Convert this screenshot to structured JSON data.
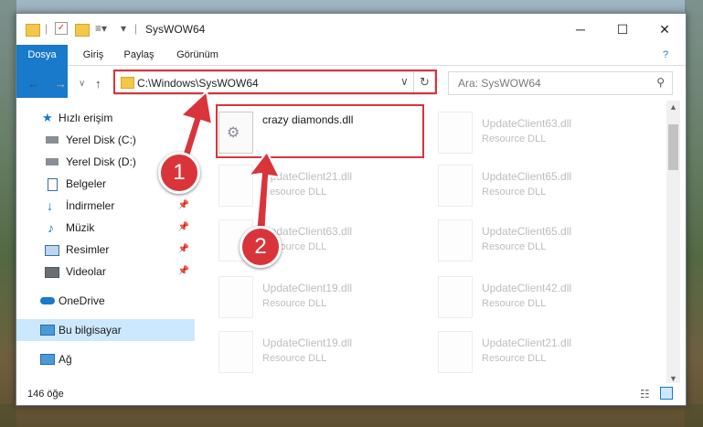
{
  "window": {
    "title": "SysWOW64",
    "minimize_glyph": "─",
    "maximize_glyph": "☐",
    "close_glyph": "✕"
  },
  "ribbon": {
    "tabs": [
      {
        "label": "Dosya",
        "active": true
      },
      {
        "label": "Giriş"
      },
      {
        "label": "Paylaş"
      },
      {
        "label": "Görünüm"
      }
    ],
    "help_glyph": "?"
  },
  "address": {
    "path": "C:\\Windows\\SysWOW64",
    "search_placeholder": "Ara: SysWOW64"
  },
  "sidebar": {
    "items": [
      {
        "label": "Hızlı erişim",
        "icon": "star-icon",
        "pinned": false
      },
      {
        "label": "Yerel Disk (C:)",
        "icon": "drive-icon",
        "pinned": false
      },
      {
        "label": "Yerel Disk (D:)",
        "icon": "drive-icon",
        "pinned": false
      },
      {
        "label": "Belgeler",
        "icon": "document-icon",
        "pinned": true
      },
      {
        "label": "İndirmeler",
        "icon": "download-icon",
        "pinned": true
      },
      {
        "label": "Müzik",
        "icon": "music-icon",
        "pinned": true
      },
      {
        "label": "Resimler",
        "icon": "pictures-icon",
        "pinned": true
      },
      {
        "label": "Videolar",
        "icon": "video-icon",
        "pinned": true
      },
      {
        "label": "OneDrive",
        "icon": "cloud-icon",
        "pinned": false
      },
      {
        "label": "Bu bilgisayar",
        "icon": "computer-icon",
        "pinned": false,
        "selected": true
      },
      {
        "label": "Ağ",
        "icon": "network-icon",
        "pinned": false
      }
    ]
  },
  "files": [
    {
      "name": "crazy diamonds.dll",
      "desc": "",
      "highlight": true
    },
    {
      "name": "UpdateClient63.dll",
      "desc": "Resource DLL"
    },
    {
      "name": "UpdateClient21.dll",
      "desc": "Resource DLL"
    },
    {
      "name": "UpdateClient65.dll",
      "desc": "Resource DLL"
    },
    {
      "name": "UpdateClient63.dll",
      "desc": "Resource DLL"
    },
    {
      "name": "UpdateClient65.dll",
      "desc": "Resource DLL"
    },
    {
      "name": "UpdateClient19.dll",
      "desc": "Resource DLL"
    },
    {
      "name": "UpdateClient42.dll",
      "desc": "Resource DLL"
    },
    {
      "name": "UpdateClient19.dll",
      "desc": "Resource DLL"
    },
    {
      "name": "UpdateClient21.dll",
      "desc": "Resource DLL"
    }
  ],
  "status": {
    "count": "146 öğe"
  },
  "annotations": {
    "marker_1": "1",
    "marker_2": "2",
    "highlight_color": "#d9343a"
  }
}
